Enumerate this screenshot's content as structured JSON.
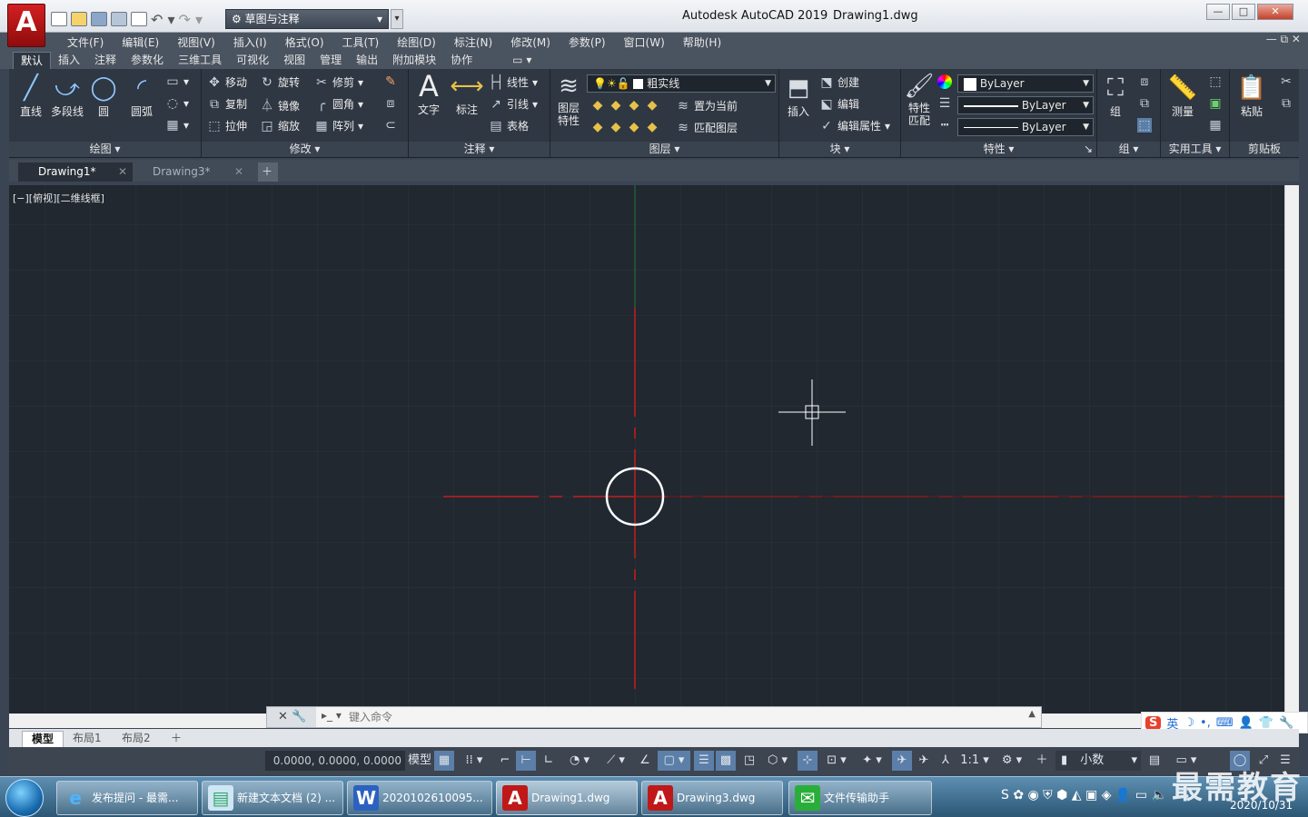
{
  "app": {
    "title": "Autodesk AutoCAD 2019",
    "document": "Drawing1.dwg",
    "logo_letter": "A",
    "workspace": "草图与注释"
  },
  "menus": [
    "文件(F)",
    "编辑(E)",
    "视图(V)",
    "插入(I)",
    "格式(O)",
    "工具(T)",
    "绘图(D)",
    "标注(N)",
    "修改(M)",
    "参数(P)",
    "窗口(W)",
    "帮助(H)"
  ],
  "ribbon_tabs": [
    "默认",
    "插入",
    "注释",
    "参数化",
    "三维工具",
    "可视化",
    "视图",
    "管理",
    "输出",
    "附加模块",
    "协作"
  ],
  "ribbon": {
    "draw": {
      "label": "绘图",
      "line": "直线",
      "polyline": "多段线",
      "circle": "圆",
      "arc": "圆弧"
    },
    "modify": {
      "label": "修改",
      "move": "移动",
      "rotate": "旋转",
      "trim": "修剪",
      "copy": "复制",
      "mirror": "镜像",
      "fillet": "圆角",
      "stretch": "拉伸",
      "scale": "缩放",
      "array": "阵列"
    },
    "annotation": {
      "label": "注释",
      "text": "文字",
      "dimension": "标注",
      "linear": "线性",
      "leader": "引线",
      "table": "表格"
    },
    "layers": {
      "label": "图层",
      "props": "图层\n特性",
      "current_layer": "粗实线",
      "set_current": "置为当前",
      "match_layer": "匹配图层"
    },
    "block": {
      "label": "块",
      "insert": "插入",
      "create": "创建",
      "edit": "编辑",
      "edit_attr": "编辑属性"
    },
    "properties": {
      "label": "特性",
      "match": "特性\n匹配",
      "color": "ByLayer",
      "linetype": "ByLayer",
      "lineweight": "ByLayer"
    },
    "groups": {
      "label": "组",
      "group": "组"
    },
    "utilities": {
      "label": "实用工具",
      "measure": "测量"
    },
    "clipboard": {
      "label": "剪贴板",
      "paste": "粘贴"
    }
  },
  "doc_tabs": [
    "Drawing1*",
    "Drawing3*"
  ],
  "viewport_label": "[−][俯视][二维线框]",
  "command": {
    "placeholder": "键入命令"
  },
  "layout_tabs": [
    "模型",
    "布局1",
    "布局2"
  ],
  "status": {
    "coords": "0.0000, 0.0000, 0.0000",
    "model": "模型",
    "scale": "1:1",
    "units": "小数"
  },
  "taskbar": [
    {
      "label": "发布提问 - 最需...",
      "icon": "ie-icon"
    },
    {
      "label": "新建文本文档 (2) ...",
      "icon": "notepad-icon"
    },
    {
      "label": "2020102610095...",
      "icon": "doc-icon"
    },
    {
      "label": "Drawing1.dwg",
      "icon": "autocad-icon"
    },
    {
      "label": "Drawing3.dwg",
      "icon": "autocad-icon"
    },
    {
      "label": "文件传输助手",
      "icon": "wechat-icon"
    }
  ],
  "tray": {
    "date": "2020/10/31",
    "ime": "英"
  },
  "watermark": "最需教育",
  "colors": {
    "canvas": "#212830",
    "axis_red": "#c41e1e",
    "axis_green": "#1e8a3a",
    "accent": "#5b7fa8"
  }
}
